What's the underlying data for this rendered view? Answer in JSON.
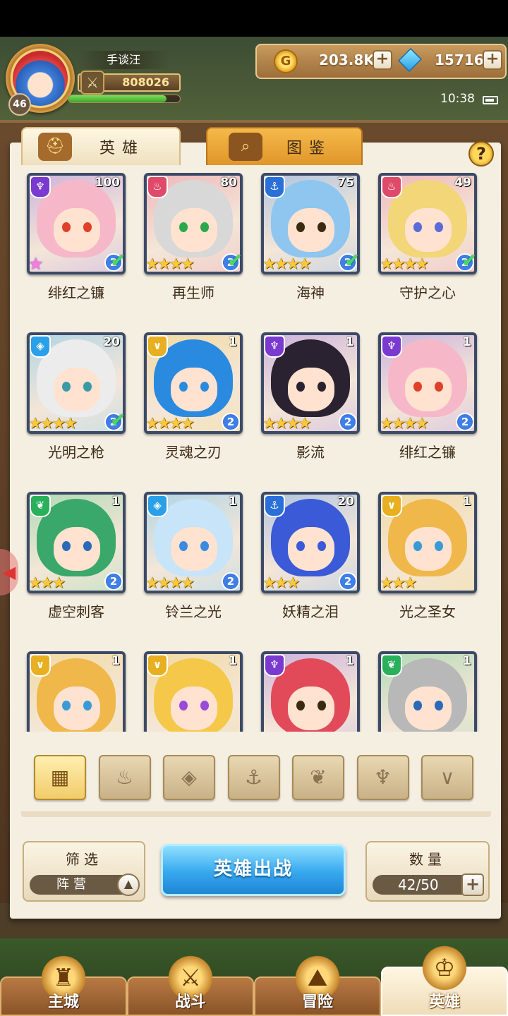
{
  "player": {
    "name": "手谈汪",
    "level": "46",
    "power": "808026",
    "exp_fraction": 0.88
  },
  "currency": {
    "gold": "203.8K",
    "gems": "15716"
  },
  "time": "10:38",
  "tabs": {
    "heroes": "英雄",
    "gallery": "图鉴"
  },
  "help_label": "?",
  "heroes": [
    {
      "name": "绯红之镰",
      "level": "100",
      "faction": "dark",
      "stars": 0,
      "rarity": true,
      "rank": "2",
      "check": true,
      "hair": "#f6b8c8",
      "eye": "#e0402a"
    },
    {
      "name": "再生师",
      "level": "80",
      "faction": "fire",
      "stars": 4,
      "rarity": false,
      "rank": "2",
      "check": true,
      "hair": "#d8d8d8",
      "eye": "#2aa84a"
    },
    {
      "name": "海神",
      "level": "75",
      "faction": "water",
      "stars": 4,
      "rarity": false,
      "rank": "2",
      "check": true,
      "hair": "#8ec6f0",
      "eye": "#3a2a10"
    },
    {
      "name": "守护之心",
      "level": "49",
      "faction": "fire",
      "stars": 4,
      "rarity": false,
      "rank": "2",
      "check": true,
      "hair": "#f2d678",
      "eye": "#5a6ad8"
    },
    {
      "name": "光明之枪",
      "level": "20",
      "faction": "wind",
      "stars": 4,
      "rarity": false,
      "rank": "2",
      "check": true,
      "hair": "#ececec",
      "eye": "#3a9aa8"
    },
    {
      "name": "灵魂之刃",
      "level": "1",
      "faction": "light",
      "stars": 4,
      "rarity": false,
      "rank": "2",
      "check": false,
      "hair": "#2a8ae0",
      "eye": "#2a8ae0"
    },
    {
      "name": "影流",
      "level": "1",
      "faction": "dark",
      "stars": 4,
      "rarity": false,
      "rank": "2",
      "check": false,
      "hair": "#2a2230",
      "eye": "#2a2230"
    },
    {
      "name": "绯红之镰",
      "level": "1",
      "faction": "dark",
      "stars": 4,
      "rarity": false,
      "rank": "2",
      "check": false,
      "hair": "#f6b8c8",
      "eye": "#e0402a"
    },
    {
      "name": "虚空刺客",
      "level": "1",
      "faction": "nature",
      "stars": 3,
      "rarity": false,
      "rank": "2",
      "check": false,
      "hair": "#3aa86a",
      "eye": "#2a6ab8"
    },
    {
      "name": "铃兰之光",
      "level": "1",
      "faction": "wind",
      "stars": 4,
      "rarity": false,
      "rank": "2",
      "check": false,
      "hair": "#c8e4f8",
      "eye": "#3a8ae0"
    },
    {
      "name": "妖精之泪",
      "level": "20",
      "faction": "water",
      "stars": 3,
      "rarity": false,
      "rank": "2",
      "check": false,
      "hair": "#3a5ad8",
      "eye": "#3a5ad8"
    },
    {
      "name": "光之圣女",
      "level": "1",
      "faction": "light",
      "stars": 3,
      "rarity": false,
      "rank": "",
      "check": false,
      "hair": "#f0b84a",
      "eye": "#3a9ad8"
    },
    {
      "name": "",
      "level": "1",
      "faction": "light",
      "stars": 0,
      "rarity": false,
      "rank": "",
      "check": false,
      "hair": "#f0b84a",
      "eye": "#3a9ad8"
    },
    {
      "name": "",
      "level": "1",
      "faction": "light",
      "stars": 0,
      "rarity": false,
      "rank": "",
      "check": false,
      "hair": "#f6c84a",
      "eye": "#9a4ad8"
    },
    {
      "name": "",
      "level": "1",
      "faction": "dark",
      "stars": 0,
      "rarity": false,
      "rank": "",
      "check": false,
      "hair": "#e24a5a",
      "eye": "#3a2a10"
    },
    {
      "name": "",
      "level": "1",
      "faction": "nature",
      "stars": 0,
      "rarity": false,
      "rank": "",
      "check": false,
      "hair": "#b8b8b8",
      "eye": "#2a6ab8"
    }
  ],
  "factions": {
    "dark": {
      "color": "#7a3ad0",
      "glyph": "♆"
    },
    "fire": {
      "color": "#e04a6a",
      "glyph": "♨"
    },
    "water": {
      "color": "#2a70d8",
      "glyph": "⚓"
    },
    "wind": {
      "color": "#2aa0e8",
      "glyph": "◈"
    },
    "light": {
      "color": "#e8b020",
      "glyph": "∨"
    },
    "nature": {
      "color": "#2ab05a",
      "glyph": "❦"
    }
  },
  "filter_buttons": [
    {
      "name": "all",
      "glyph": "▦",
      "active": true
    },
    {
      "name": "fire",
      "glyph": "♨",
      "active": false
    },
    {
      "name": "wind",
      "glyph": "◈",
      "active": false
    },
    {
      "name": "water",
      "glyph": "⚓",
      "active": false
    },
    {
      "name": "nature",
      "glyph": "❦",
      "active": false
    },
    {
      "name": "dark",
      "glyph": "♆",
      "active": false
    },
    {
      "name": "light",
      "glyph": "∨",
      "active": false
    }
  ],
  "filter_panel": {
    "title": "筛选",
    "value": "阵营"
  },
  "deploy_button": "英雄出战",
  "count_panel": {
    "title": "数量",
    "value": "42/50"
  },
  "nav": [
    {
      "label": "主城",
      "icon": "castle-icon",
      "glyph": "♜",
      "active": false
    },
    {
      "label": "战斗",
      "icon": "swords-icon",
      "glyph": "⚔",
      "active": false
    },
    {
      "label": "冒险",
      "icon": "map-icon",
      "glyph": "⛰",
      "active": false
    },
    {
      "label": "英雄",
      "icon": "helmet-icon",
      "glyph": "♔",
      "active": true
    }
  ]
}
